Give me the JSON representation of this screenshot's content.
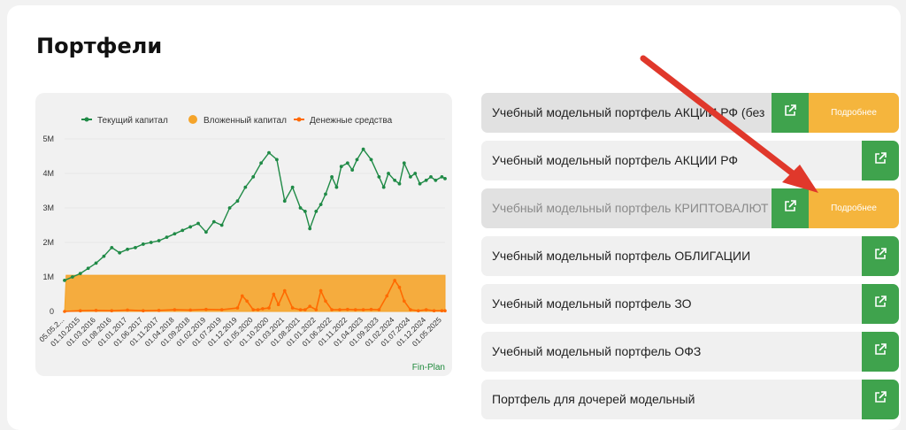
{
  "page": {
    "title": "Портфели"
  },
  "colors": {
    "capital": "#1f8a46",
    "invested": "#f5a42a",
    "cash": "#ff6a00",
    "green_button": "#3fa34d",
    "orange_button": "#f5b53d",
    "arrow": "#e0382b"
  },
  "chart_data": {
    "type": "line",
    "legend_position": "top",
    "legend": [
      "Текущий капитал",
      "Вложенный капитал",
      "Денежные средства"
    ],
    "y_ticks": [
      "5M",
      "4M",
      "3M",
      "2M",
      "1M",
      "0"
    ],
    "ylim": [
      0,
      5000000
    ],
    "x_ticks": [
      "05.05.2...",
      "01.10.2015",
      "01.03.2016",
      "01.08.2016",
      "01.01.2017",
      "01.06.2017",
      "01.11.2017",
      "01.04.2018",
      "01.09.2018",
      "01.02.2019",
      "01.07.2019",
      "01.12.2019",
      "01.05.2020",
      "01.10.2020",
      "01.03.2021",
      "01.08.2021",
      "01.01.2022",
      "01.06.2022",
      "01.11.2022",
      "01.04.2023",
      "01.09.2023",
      "01.02.2024",
      "01.07.2024",
      "01.12.2024",
      "01.05.2025"
    ],
    "series": [
      {
        "name": "Текущий капитал",
        "x": [
          0,
          0.5,
          1,
          1.5,
          2,
          2.5,
          3,
          3.5,
          4,
          4.5,
          5,
          5.5,
          6,
          6.5,
          7,
          7.5,
          8,
          8.5,
          9,
          9.5,
          10,
          10.5,
          11,
          11.5,
          12,
          12.5,
          13,
          13.5,
          14,
          14.5,
          15,
          15.3,
          15.6,
          16,
          16.3,
          16.6,
          17,
          17.3,
          17.6,
          18,
          18.3,
          18.6,
          19,
          19.5,
          20,
          20.3,
          20.6,
          21,
          21.3,
          21.6,
          22,
          22.3,
          22.6,
          23,
          23.3,
          23.6,
          24,
          24.2
        ],
        "values": [
          0.9,
          1.0,
          1.1,
          1.25,
          1.4,
          1.6,
          1.85,
          1.7,
          1.8,
          1.85,
          1.95,
          2.0,
          2.05,
          2.15,
          2.25,
          2.35,
          2.45,
          2.55,
          2.3,
          2.6,
          2.5,
          3.0,
          3.2,
          3.6,
          3.9,
          4.3,
          4.6,
          4.4,
          3.2,
          3.6,
          3.0,
          2.9,
          2.4,
          2.9,
          3.1,
          3.4,
          3.9,
          3.6,
          4.2,
          4.3,
          4.1,
          4.4,
          4.7,
          4.4,
          3.9,
          3.6,
          4.0,
          3.8,
          3.7,
          4.3,
          3.9,
          4.0,
          3.7,
          3.8,
          3.9,
          3.8,
          3.9,
          3.85
        ]
      },
      {
        "name": "Вложенный капитал",
        "x": [
          0,
          0.1,
          24.2
        ],
        "values": [
          0,
          1.05,
          1.05
        ]
      },
      {
        "name": "Денежные средства",
        "x": [
          0,
          1,
          2,
          3,
          4,
          5,
          6,
          7,
          8,
          9,
          10,
          11,
          11.3,
          11.6,
          12,
          12.3,
          12.6,
          13,
          13.3,
          13.6,
          14,
          14.5,
          15,
          15.3,
          15.6,
          16,
          16.3,
          16.6,
          17,
          17.5,
          18,
          18.5,
          19,
          19.5,
          20,
          20.5,
          21,
          21.3,
          21.6,
          22,
          22.5,
          23,
          23.5,
          24,
          24.2
        ],
        "values": [
          0,
          0.02,
          0.03,
          0.02,
          0.04,
          0.02,
          0.03,
          0.05,
          0.04,
          0.06,
          0.05,
          0.1,
          0.45,
          0.3,
          0.05,
          0.05,
          0.08,
          0.1,
          0.5,
          0.2,
          0.6,
          0.1,
          0.05,
          0.05,
          0.15,
          0.05,
          0.6,
          0.3,
          0.05,
          0.05,
          0.06,
          0.05,
          0.05,
          0.06,
          0.05,
          0.45,
          0.9,
          0.7,
          0.3,
          0.05,
          0.02,
          0.05,
          0.02,
          0.02,
          0.02
        ]
      }
    ]
  },
  "chart_credit": "Fin-Plan",
  "portfolios": [
    {
      "label": "Учебный модельный портфель АКЦИИ РФ (без",
      "more": "Подробнее",
      "active": true,
      "dim": false
    },
    {
      "label": "Учебный модельный портфель АКЦИИ РФ",
      "more": "",
      "active": false,
      "dim": false
    },
    {
      "label": "Учебный модельный портфель КРИПТОВАЛЮТ",
      "more": "Подробнее",
      "active": true,
      "dim": true
    },
    {
      "label": "Учебный модельный портфель ОБЛИГАЦИИ",
      "more": "",
      "active": false,
      "dim": false
    },
    {
      "label": "Учебный модельный портфель ЗО",
      "more": "",
      "active": false,
      "dim": false
    },
    {
      "label": "Учебный модельный портфель ОФЗ",
      "more": "",
      "active": false,
      "dim": false
    },
    {
      "label": "Портфель для дочерей модельный",
      "more": "",
      "active": false,
      "dim": false
    }
  ]
}
